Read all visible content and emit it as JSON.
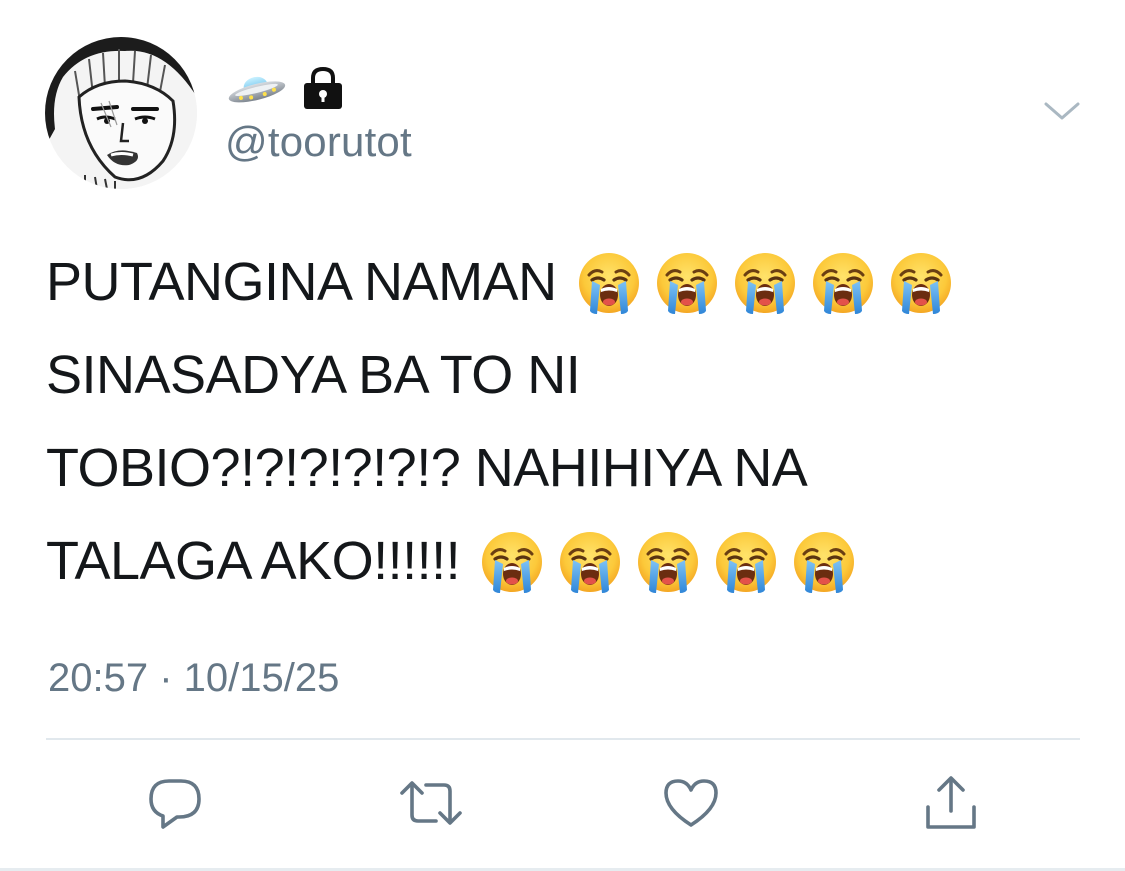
{
  "user": {
    "display_name_icons": [
      "flying-saucer-icon",
      "lock-icon"
    ],
    "handle": "@toorutot"
  },
  "tweet": {
    "lines": [
      {
        "text": "PUTANGINA NAMAN",
        "emoji_count": 5
      },
      {
        "text": "SINASADYA BA TO NI",
        "emoji_count": 0
      },
      {
        "text": "TOBIO?!?!?!?!?!? NAHIHIYA NA",
        "emoji_count": 0
      },
      {
        "text": "TALAGA AKO!!!!!!",
        "emoji_count": 5
      }
    ],
    "emoji": "loudly-crying-face-emoji"
  },
  "meta": {
    "timestamp": "20:57 · 10/15/25"
  },
  "actions": [
    "reply-icon",
    "retweet-icon",
    "like-icon",
    "share-icon"
  ],
  "colors": {
    "text": "#14171a",
    "secondary": "#657786",
    "divider": "#e1e8ed"
  }
}
